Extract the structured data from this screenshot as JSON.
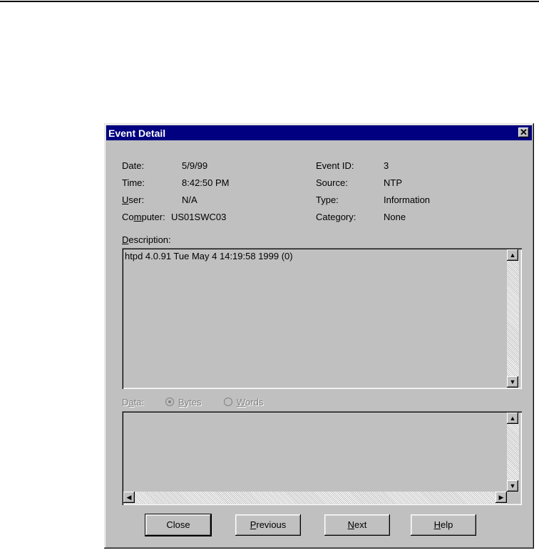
{
  "window": {
    "title": "Event Detail",
    "close_glyph": "✕"
  },
  "details": {
    "date": {
      "label": "Date:",
      "value": "5/9/99"
    },
    "time": {
      "label": "Time:",
      "value": "8:42:50 PM"
    },
    "user": {
      "label_pre": "",
      "label_u": "U",
      "label_post": "ser:",
      "value": "N/A"
    },
    "computer": {
      "label_pre": "Co",
      "label_u": "m",
      "label_post": "puter:",
      "value": "US01SWC03"
    },
    "event_id": {
      "label": "Event ID:",
      "value": "3"
    },
    "source": {
      "label": "Source:",
      "value": "NTP"
    },
    "type": {
      "label": "Type:",
      "value": "Information"
    },
    "category": {
      "label": "Category:",
      "value": "None"
    }
  },
  "description": {
    "label_u": "D",
    "label_post": "escription:",
    "text": "htpd 4.0.91 Tue May  4 14:19:58 1999 (0)"
  },
  "data": {
    "label_pre": "D",
    "label_u": "a",
    "label_post": "ta:",
    "bytes_u": "B",
    "bytes_post": "ytes",
    "words_u": "W",
    "words_post": "ords",
    "selected": "Bytes"
  },
  "buttons": {
    "close": "Close",
    "previous_u": "P",
    "previous_post": "revious",
    "next_u": "N",
    "next_post": "ext",
    "help_u": "H",
    "help_post": "elp"
  },
  "colors": {
    "titlebar": "#000080",
    "face": "#c0c0c0"
  }
}
